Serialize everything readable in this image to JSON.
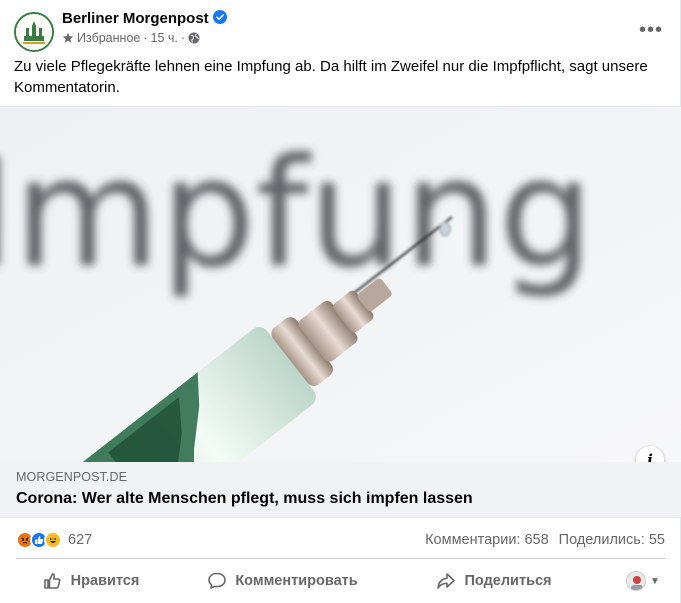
{
  "post": {
    "page_name": "Berliner Morgenpost",
    "audience_label": "Избранное",
    "time_ago": "15 ч.",
    "separator": "·",
    "text": "Zu viele Pflegekräfte lehnen eine Impfung ab. Da hilft im Zweifel nur die Impfpflicht, sagt unsere Kommentatorin."
  },
  "image": {
    "background_word": "Impfung"
  },
  "link": {
    "domain": "MORGENPOST.DE",
    "title": "Corona: Wer alte Menschen pflegt, muss sich impfen lassen"
  },
  "stats": {
    "reactions_count": "627",
    "comments": "Комментарии: 658",
    "shares": "Поделились: 55"
  },
  "actions": {
    "like": "Нравится",
    "comment": "Комментировать",
    "share": "Поделиться"
  },
  "icons": {
    "verified": "verified-badge-icon",
    "star": "star-icon",
    "globe": "globe-icon",
    "more": "more-options-icon",
    "info": "info-icon",
    "angry": "angry-reaction-icon",
    "like": "like-reaction-icon",
    "haha": "haha-reaction-icon",
    "thumb": "thumbs-up-icon",
    "comment": "comment-bubble-icon",
    "share": "share-arrow-icon",
    "caret": "caret-down-icon"
  },
  "colors": {
    "facebook_blue": "#1877f2",
    "secondary_text": "#65676b",
    "link_box_bg": "#f0f2f5",
    "angry": "#e9710f",
    "like": "#1877f2",
    "haha": "#f7b928"
  }
}
